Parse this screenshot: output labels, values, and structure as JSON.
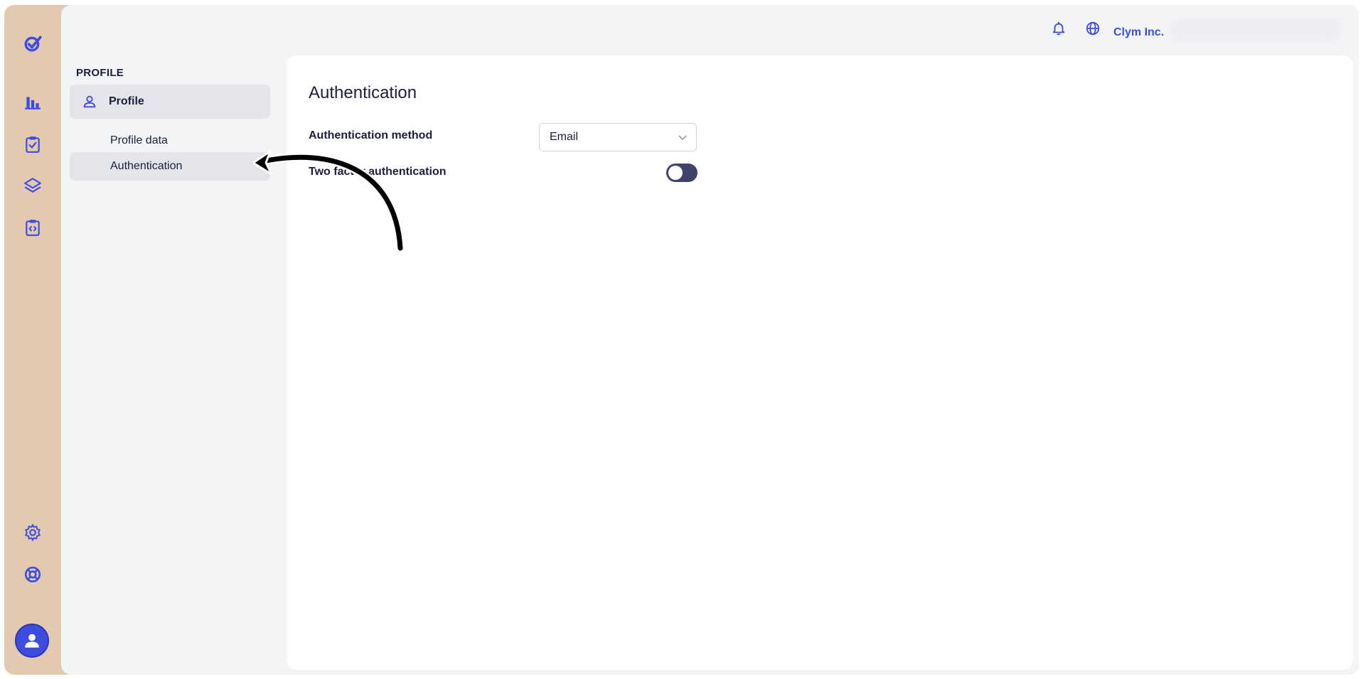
{
  "colors": {
    "accent": "#3d4de0",
    "frame": "#e3c8b2",
    "toggle_off": "#40426b"
  },
  "rail": {
    "items": [
      {
        "icon": "logo-check-icon"
      },
      {
        "icon": "bar-chart-icon"
      },
      {
        "icon": "clipboard-check-icon"
      },
      {
        "icon": "layers-icon"
      },
      {
        "icon": "clipboard-code-icon"
      },
      {
        "icon": "gear-icon"
      },
      {
        "icon": "lifebuoy-icon"
      },
      {
        "icon": "user-avatar-icon"
      }
    ]
  },
  "topbar": {
    "company": "Clym Inc.",
    "icons": [
      "bell-icon",
      "globe-icon"
    ]
  },
  "sidebar": {
    "section_title": "PROFILE",
    "primary": {
      "label": "Profile",
      "icon": "person-icon"
    },
    "items": [
      {
        "label": "Profile data",
        "active": false
      },
      {
        "label": "Authentication",
        "active": true
      }
    ]
  },
  "main": {
    "title": "Authentication",
    "fields": {
      "method_label": "Authentication method",
      "method_value": "Email",
      "two_factor_label": "Two factor authentication",
      "two_factor_enabled": false
    }
  }
}
